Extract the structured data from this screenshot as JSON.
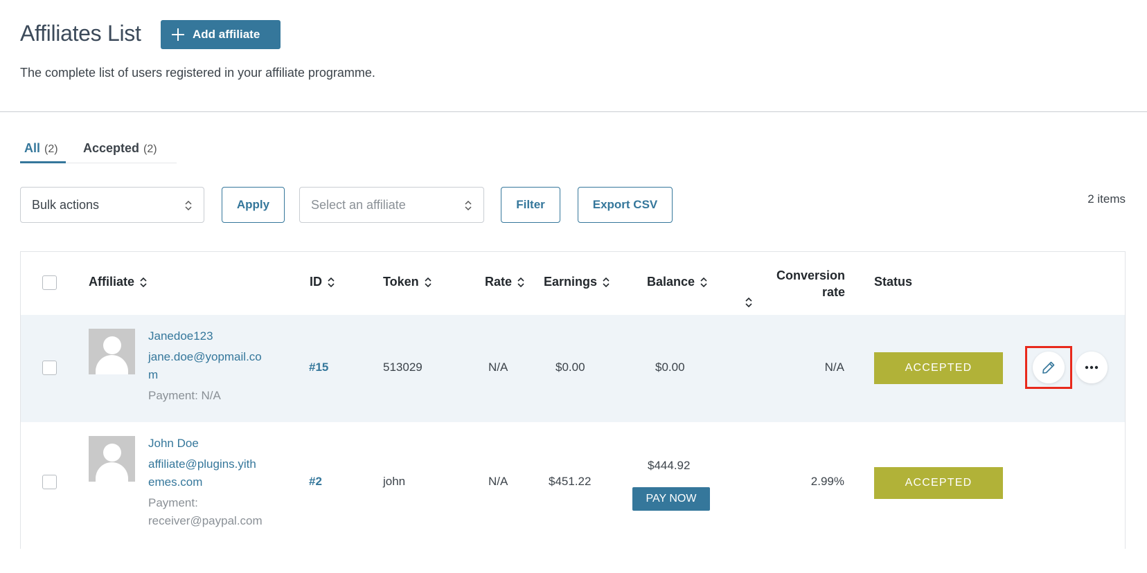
{
  "header": {
    "title": "Affiliates List",
    "add_button_label": "Add affiliate",
    "subtitle": "The complete list of users registered in your affiliate programme."
  },
  "tabs": [
    {
      "label": "All",
      "count": "(2)",
      "active": true
    },
    {
      "label": "Accepted",
      "count": "(2)",
      "active": false
    }
  ],
  "toolbar": {
    "bulk_actions": "Bulk actions",
    "apply_label": "Apply",
    "affiliate_placeholder": "Select an affiliate",
    "filter_label": "Filter",
    "export_label": "Export CSV",
    "items_count": "2 items"
  },
  "table": {
    "columns": {
      "affiliate": "Affiliate",
      "id": "ID",
      "token": "Token",
      "rate": "Rate",
      "earnings": "Earnings",
      "balance": "Balance",
      "conversion_line1": "Conversion",
      "conversion_line2": "rate",
      "status": "Status"
    },
    "rows": [
      {
        "username": "Janedoe123",
        "email_line1": "jane.doe@yopmail.co",
        "email_line2": "m",
        "payment_line1": "Payment: N/A",
        "payment_line2": "",
        "id": "#15",
        "token": "513029",
        "rate": "N/A",
        "earnings": "$0.00",
        "balance": "$0.00",
        "conversion": "N/A",
        "status": "ACCEPTED"
      },
      {
        "username": "John Doe",
        "email_line1": "affiliate@plugins.yith",
        "email_line2": "emes.com",
        "payment_line1": "Payment:",
        "payment_line2": "receiver@paypal.com",
        "id": "#2",
        "token": "john",
        "rate": "N/A",
        "earnings": "$451.22",
        "balance": "$444.92",
        "pay_now": "PAY NOW",
        "conversion": "2.99%",
        "status": "ACCEPTED"
      }
    ]
  },
  "colors": {
    "primary": "#35779b",
    "status_accepted": "#b1b238",
    "highlight": "#e8291c",
    "row_highlight": "#eff4f8"
  }
}
